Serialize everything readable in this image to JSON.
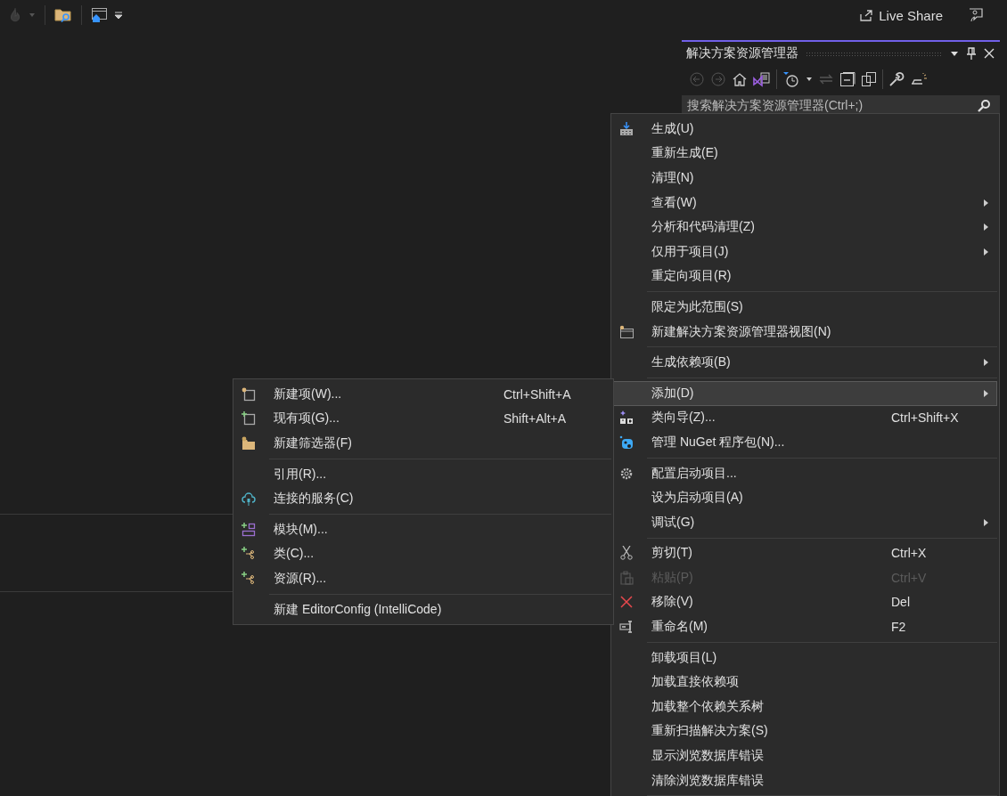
{
  "toolbar": {
    "live_share": "Live Share"
  },
  "solution_explorer": {
    "title": "解决方案资源管理器",
    "search": {
      "placeholder": "搜索解决方案资源管理器(Ctrl+;)"
    }
  },
  "context_menu": {
    "items": [
      {
        "kind": "item",
        "label": "生成(U)",
        "submenu": false,
        "selected": false,
        "disabled": false
      },
      {
        "kind": "item",
        "label": "重新生成(E)",
        "submenu": false,
        "selected": false,
        "disabled": false
      },
      {
        "kind": "item",
        "label": "清理(N)",
        "submenu": false,
        "selected": false,
        "disabled": false
      },
      {
        "kind": "item",
        "label": "查看(W)",
        "submenu": true,
        "selected": false,
        "disabled": false
      },
      {
        "kind": "item",
        "label": "分析和代码清理(Z)",
        "submenu": true,
        "selected": false,
        "disabled": false
      },
      {
        "kind": "item",
        "label": "仅用于项目(J)",
        "submenu": true,
        "selected": false,
        "disabled": false
      },
      {
        "kind": "item",
        "label": "重定向项目(R)",
        "submenu": false,
        "selected": false,
        "disabled": false
      },
      {
        "kind": "separator"
      },
      {
        "kind": "item",
        "label": "限定为此范围(S)",
        "submenu": false,
        "selected": false,
        "disabled": false
      },
      {
        "kind": "item",
        "label": "新建解决方案资源管理器视图(N)",
        "submenu": false,
        "selected": false,
        "disabled": false
      },
      {
        "kind": "separator"
      },
      {
        "kind": "item",
        "label": "生成依赖项(B)",
        "submenu": true,
        "selected": false,
        "disabled": false
      },
      {
        "kind": "separator"
      },
      {
        "kind": "item",
        "label": "添加(D)",
        "submenu": true,
        "selected": true,
        "disabled": false
      },
      {
        "kind": "item",
        "label": "类向导(Z)...",
        "shortcut": "Ctrl+Shift+X",
        "submenu": false,
        "selected": false,
        "disabled": false
      },
      {
        "kind": "item",
        "label": "管理 NuGet 程序包(N)...",
        "submenu": false,
        "selected": false,
        "disabled": false
      },
      {
        "kind": "separator"
      },
      {
        "kind": "item",
        "label": "配置启动项目...",
        "submenu": false,
        "selected": false,
        "disabled": false
      },
      {
        "kind": "item",
        "label": "设为启动项目(A)",
        "submenu": false,
        "selected": false,
        "disabled": false
      },
      {
        "kind": "item",
        "label": "调试(G)",
        "submenu": true,
        "selected": false,
        "disabled": false
      },
      {
        "kind": "separator"
      },
      {
        "kind": "item",
        "label": "剪切(T)",
        "shortcut": "Ctrl+X",
        "submenu": false,
        "selected": false,
        "disabled": false
      },
      {
        "kind": "item",
        "label": "粘贴(P)",
        "shortcut": "Ctrl+V",
        "submenu": false,
        "selected": false,
        "disabled": true
      },
      {
        "kind": "item",
        "label": "移除(V)",
        "shortcut": "Del",
        "submenu": false,
        "selected": false,
        "disabled": false
      },
      {
        "kind": "item",
        "label": "重命名(M)",
        "shortcut": "F2",
        "submenu": false,
        "selected": false,
        "disabled": false
      },
      {
        "kind": "separator"
      },
      {
        "kind": "item",
        "label": "卸载项目(L)",
        "submenu": false,
        "selected": false,
        "disabled": false
      },
      {
        "kind": "item",
        "label": "加载直接依赖项",
        "submenu": false,
        "selected": false,
        "disabled": false
      },
      {
        "kind": "item",
        "label": "加载整个依赖关系树",
        "submenu": false,
        "selected": false,
        "disabled": false
      },
      {
        "kind": "item",
        "label": "重新扫描解决方案(S)",
        "submenu": false,
        "selected": false,
        "disabled": false
      },
      {
        "kind": "item",
        "label": "显示浏览数据库错误",
        "submenu": false,
        "selected": false,
        "disabled": false
      },
      {
        "kind": "item",
        "label": "清除浏览数据库错误",
        "submenu": false,
        "selected": false,
        "disabled": false
      },
      {
        "kind": "separator"
      }
    ]
  },
  "add_submenu": {
    "items": [
      {
        "kind": "item",
        "label": "新建项(W)...",
        "shortcut": "Ctrl+Shift+A",
        "submenu": false,
        "selected": false,
        "disabled": false
      },
      {
        "kind": "item",
        "label": "现有项(G)...",
        "shortcut": "Shift+Alt+A",
        "submenu": false,
        "selected": false,
        "disabled": false
      },
      {
        "kind": "item",
        "label": "新建筛选器(F)",
        "submenu": false,
        "selected": false,
        "disabled": false
      },
      {
        "kind": "separator"
      },
      {
        "kind": "item",
        "label": "引用(R)...",
        "submenu": false,
        "selected": false,
        "disabled": false
      },
      {
        "kind": "item",
        "label": "连接的服务(C)",
        "submenu": false,
        "selected": false,
        "disabled": false
      },
      {
        "kind": "separator"
      },
      {
        "kind": "item",
        "label": "模块(M)...",
        "submenu": false,
        "selected": false,
        "disabled": false
      },
      {
        "kind": "item",
        "label": "类(C)...",
        "submenu": false,
        "selected": false,
        "disabled": false
      },
      {
        "kind": "item",
        "label": "资源(R)...",
        "submenu": false,
        "selected": false,
        "disabled": false
      },
      {
        "kind": "separator"
      },
      {
        "kind": "item",
        "label": "新建 EditorConfig (IntelliCode)",
        "submenu": false,
        "selected": false,
        "disabled": false
      }
    ]
  }
}
